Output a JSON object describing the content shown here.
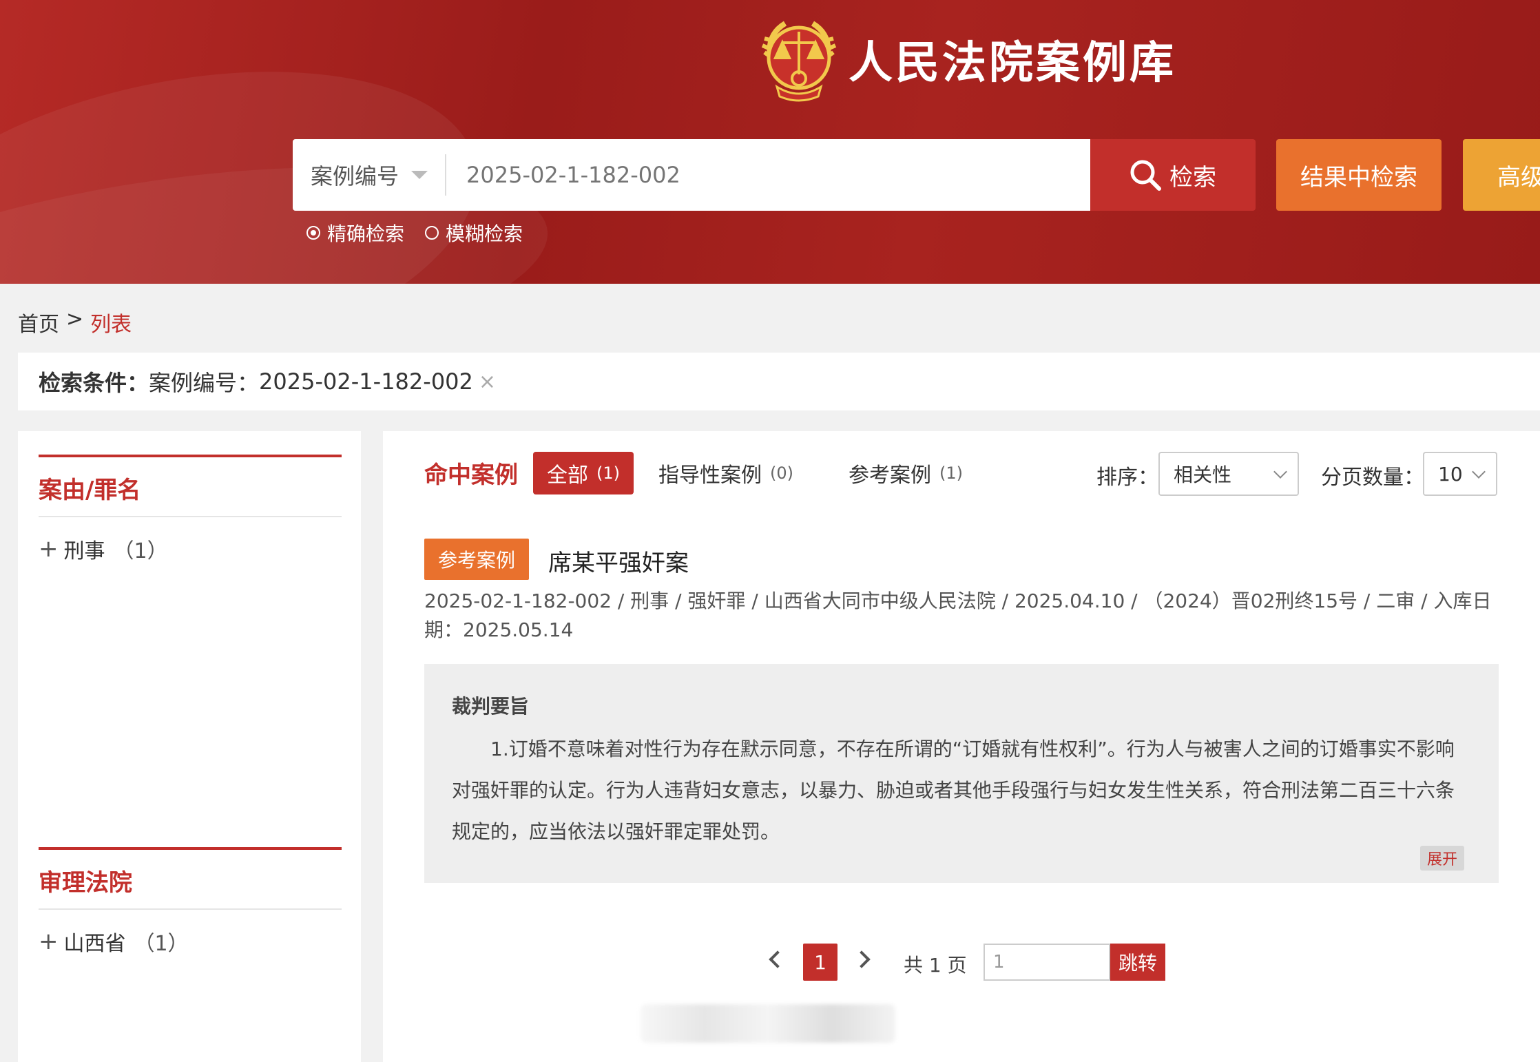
{
  "header": {
    "site_title": "人民法院案例库",
    "emblem": "court-emblem-icon",
    "search": {
      "type_label": "案例编号",
      "placeholder": "2025-02-1-182-002",
      "search_button": "检索",
      "result_search_button": "结果中检索",
      "advanced_button": "高级"
    },
    "modes": [
      {
        "label": "精确检索",
        "checked": true
      },
      {
        "label": "模糊检索",
        "checked": false
      }
    ],
    "colors": {
      "primary": "#c22f2b",
      "orange": "#e9712d",
      "amber": "#eda334"
    }
  },
  "breadcrumb": {
    "home": "首页",
    "sep": ">",
    "current": "列表"
  },
  "conditions": {
    "label": "检索条件：",
    "key": "案例编号：",
    "value": "2025-02-1-182-002",
    "remove": "×"
  },
  "sidebar": {
    "facets": [
      {
        "title": "案由/罪名",
        "items": [
          {
            "label": "刑事",
            "count": "（1）"
          }
        ]
      },
      {
        "title": "审理法院",
        "items": [
          {
            "label": "山西省",
            "count": "（1）"
          }
        ]
      }
    ]
  },
  "results": {
    "title": "命中案例",
    "tabs": [
      {
        "label": "全部",
        "count": "(1)",
        "active": true
      },
      {
        "label": "指导性案例",
        "count": "(0)",
        "active": false
      },
      {
        "label": "参考案例",
        "count": "(1)",
        "active": false
      }
    ],
    "sort_label": "排序：",
    "sort_value": "相关性",
    "page_size_label": "分页数量：",
    "page_size_value": "10",
    "case": {
      "badge": "参考案例",
      "title": "席某平强奸案",
      "meta": "2025-02-1-182-002 / 刑事 / 强奸罪 / 山西省大同市中级人民法院 / 2025.04.10 / （2024）晋02刑终15号 / 二审 / 入库日期：2025.05.14",
      "summary_title": "裁判要旨",
      "summary_text": "1.订婚不意味着对性行为存在默示同意，不存在所谓的“订婚就有性权利”。行为人与被害人之间的订婚事实不影响对强奸罪的认定。行为人违背妇女意志，以暴力、胁迫或者其他手段强行与妇女发生性关系，符合刑法第二百三十六条规定的，应当依法以强奸罪定罪处罚。",
      "expand": "展开"
    }
  },
  "pagination": {
    "current": "1",
    "total": "共 1 页",
    "jump_value": "1",
    "jump_button": "跳转"
  }
}
